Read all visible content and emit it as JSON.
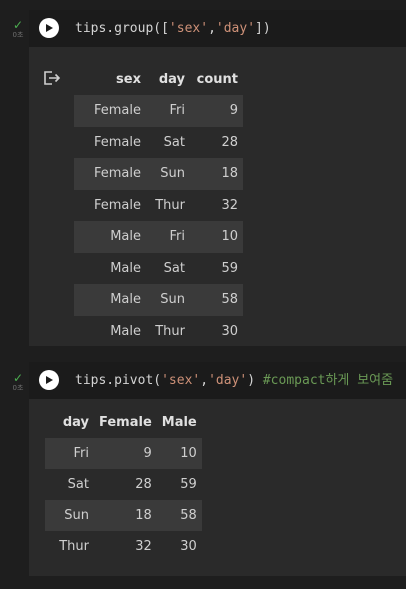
{
  "cells": [
    {
      "status": "✓",
      "time": "0초",
      "code": {
        "prefix": "tips.group([",
        "str1": "'sex'",
        "sep": ",",
        "str2": "'day'",
        "suffix": "])"
      },
      "table": {
        "headers": [
          "sex",
          "day",
          "count"
        ],
        "rows": [
          [
            "Female",
            "Fri",
            "9"
          ],
          [
            "Female",
            "Sat",
            "28"
          ],
          [
            "Female",
            "Sun",
            "18"
          ],
          [
            "Female",
            "Thur",
            "32"
          ],
          [
            "Male",
            "Fri",
            "10"
          ],
          [
            "Male",
            "Sat",
            "59"
          ],
          [
            "Male",
            "Sun",
            "58"
          ],
          [
            "Male",
            "Thur",
            "30"
          ]
        ]
      }
    },
    {
      "status": "✓",
      "time": "0초",
      "code": {
        "prefix": "tips.pivot(",
        "str1": "'sex'",
        "sep": ",",
        "str2": "'day'",
        "suffix": ") ",
        "comment": "#compact하게 보여줌"
      },
      "table": {
        "headers": [
          "day",
          "Female",
          "Male"
        ],
        "rows": [
          [
            "Fri",
            "9",
            "10"
          ],
          [
            "Sat",
            "28",
            "59"
          ],
          [
            "Sun",
            "18",
            "58"
          ],
          [
            "Thur",
            "32",
            "30"
          ]
        ]
      }
    }
  ],
  "colors": {
    "background": "#1e1e1e",
    "cell": "#2a2a2a",
    "string": "#ce9178",
    "comment": "#6a9955",
    "check": "#4caf50"
  },
  "icons": {
    "run": "play-icon",
    "output": "output-exit-icon",
    "status": "check-icon"
  }
}
